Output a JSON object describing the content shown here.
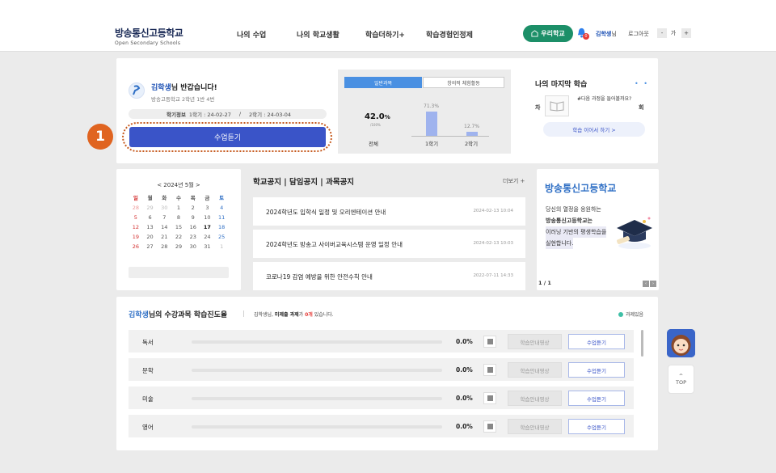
{
  "header": {
    "logo_ko": "방송통신고등학교",
    "logo_en": "Open Secondary Schools",
    "nav": [
      "나의 수업",
      "나의 학교생활",
      "학습더하기+",
      "학습경험인정제"
    ],
    "our_school": "우리학교",
    "bell_count": "0",
    "user_name": "김학생",
    "user_suffix": "님",
    "logout": "로그아웃",
    "font_minus": "-",
    "font_label": "가",
    "font_plus": "+"
  },
  "welcome": {
    "name": "김학생",
    "greeting_suffix": "님 반갑습니다!",
    "sub": "방송고등학교 2학년 1반 4번",
    "term_label": "학기정보",
    "term1": "1학기 : 24-02-27",
    "separator": "/",
    "term2": "2학기 : 24-03-04",
    "attend_button": "수업듣기",
    "callout_number": "1"
  },
  "stats": {
    "tab_general": "일반과목",
    "tab_creative": "창의적 체험활동",
    "total_pct": "42.0",
    "total_unit": "%",
    "total_sub": "/100%",
    "total_label": "전체",
    "bars": [
      {
        "label": "1학기",
        "value": 71.3,
        "text": "71.3%"
      },
      {
        "label": "2학기",
        "value": 12.7,
        "text": "12.7%"
      }
    ]
  },
  "last_lesson": {
    "title": "나의 마지막 학습",
    "dots": "• •",
    "cha": "차",
    "hoe": "회",
    "prompt": "#다음 과정을 들어볼까요?",
    "continue_button": "학습 이어서 하기  >"
  },
  "calendar": {
    "header": "< 2024년 5월 >",
    "days": [
      "일",
      "월",
      "화",
      "수",
      "목",
      "금",
      "토"
    ],
    "weeks": [
      [
        "28",
        "29",
        "30",
        "1",
        "2",
        "3",
        "4"
      ],
      [
        "5",
        "6",
        "7",
        "8",
        "9",
        "10",
        "11"
      ],
      [
        "12",
        "13",
        "14",
        "15",
        "16",
        "17",
        "18"
      ],
      [
        "19",
        "20",
        "21",
        "22",
        "23",
        "24",
        "25"
      ],
      [
        "26",
        "27",
        "28",
        "29",
        "30",
        "31",
        "1"
      ]
    ]
  },
  "notices": {
    "tabs": "학교공지  |  담임공지  |  과목공지",
    "more": "더보기 +",
    "items": [
      {
        "title": "2024학년도 입학식 일정 및 오리엔테이션 안내",
        "date": "2024-02-13 10:04"
      },
      {
        "title": "2024학년도 방송고 사이버교육시스템 운영 일정 안내",
        "date": "2024-02-13 10:03"
      },
      {
        "title": "코로나19 감염 예방을 위한 안전수칙 안내",
        "date": "2022-07-11 14:33"
      }
    ]
  },
  "promo": {
    "title": "방송통신고등학교",
    "line1": "당신의 열정을 응원하는",
    "line2": "방송통신고등학교는",
    "line3": "이러닝 기반의 평생학습을",
    "line4": "실현합니다.",
    "pager": "1 / 1"
  },
  "progress": {
    "name": "김학생",
    "title_suffix": "님의 수강과목 학습진도율",
    "divider": "|",
    "note_prefix": "김학생님,",
    "note_bold": "미제출 과제",
    "note_mid": "가",
    "note_count": "0개",
    "note_suffix": "있습니다.",
    "legend": "과제있음",
    "subjects": [
      {
        "name": "독서",
        "pct": "0.0%",
        "guide": "학습안내영상",
        "attend": "수업듣기"
      },
      {
        "name": "문학",
        "pct": "0.0%",
        "guide": "학습안내영상",
        "attend": "수업듣기"
      },
      {
        "name": "미술",
        "pct": "0.0%",
        "guide": "학습안내영상",
        "attend": "수업듣기"
      },
      {
        "name": "영어",
        "pct": "0.0%",
        "guide": "학습안내영상",
        "attend": "수업듣기"
      }
    ]
  },
  "floating": {
    "top_label": "TOP",
    "top_arrow": "^"
  }
}
